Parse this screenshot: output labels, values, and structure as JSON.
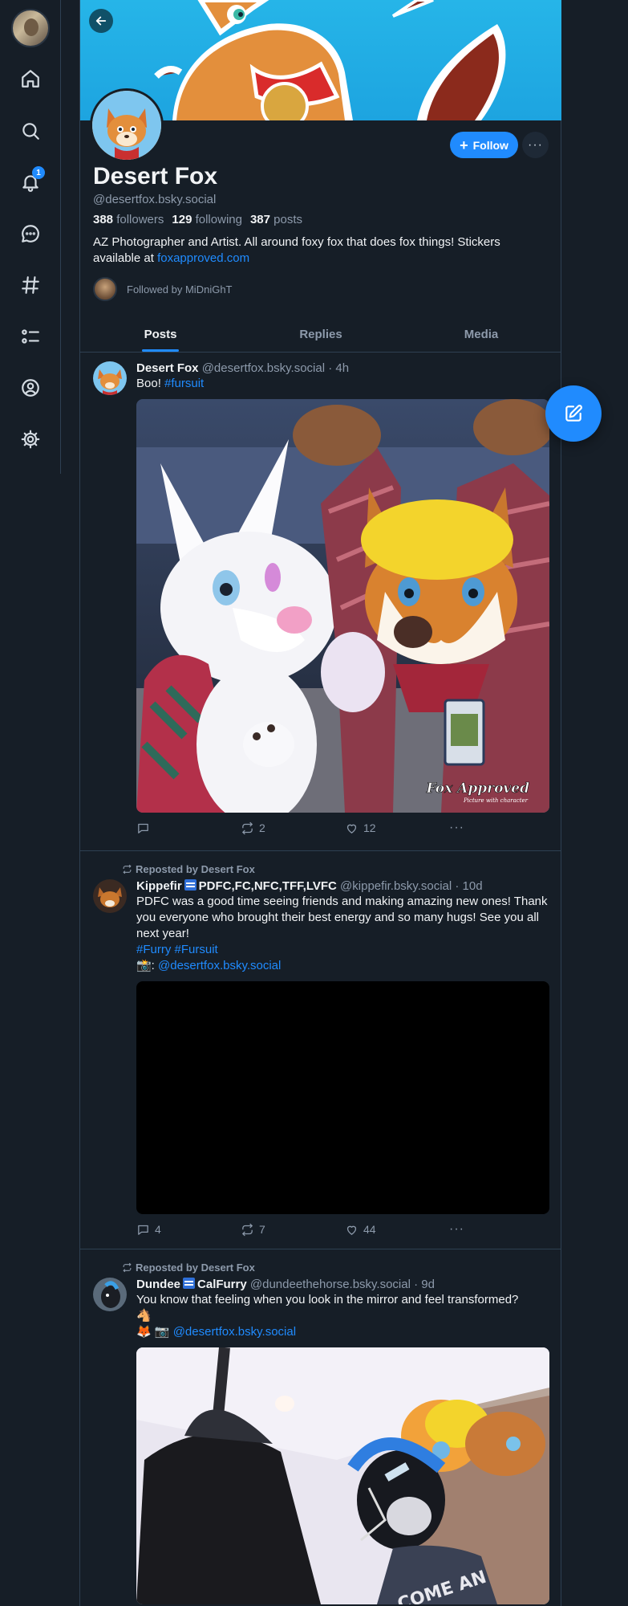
{
  "nav": {
    "notification_count": "1",
    "icons": [
      "home-icon",
      "search-icon",
      "bell-icon",
      "chat-icon",
      "hashtag-icon",
      "list-icon",
      "profile-icon",
      "settings-icon"
    ]
  },
  "profile": {
    "display_name": "Desert Fox",
    "handle": "@desertfox.bsky.social",
    "followers_count": "388",
    "followers_label": "followers",
    "following_count": "129",
    "following_label": "following",
    "posts_count": "387",
    "posts_label": "posts",
    "bio_text": "AZ Photographer and Artist. All around foxy fox that does fox things! Stickers available at ",
    "bio_link": "foxapproved.com",
    "followed_by": "Followed by MiDniGhT",
    "follow_label": "Follow",
    "more_label": "···"
  },
  "tabs": [
    {
      "label": "Posts",
      "active": true
    },
    {
      "label": "Replies",
      "active": false
    },
    {
      "label": "Media",
      "active": false
    }
  ],
  "posts": [
    {
      "author": "Desert Fox",
      "handle": "@desertfox.bsky.social",
      "time": "· 4h",
      "text": "Boo! ",
      "tag": "#fursuit",
      "replies": "",
      "reposts": "2",
      "likes": "12",
      "watermark_main": "Fox Approved",
      "watermark_sub": "Picture with character"
    },
    {
      "repost_label": "Reposted by Desert Fox",
      "author": "Kippefir",
      "author_suffix": "PDFC,FC,NFC,TFF,LVFC",
      "handle": "@kippefir.bsky.social",
      "time": "· 10d",
      "text": "PDFC was a good time seeing friends and making amazing new ones! Thank you everyone who brought their best energy and so many hugs! See you all next year!",
      "tags": "#Furry #Fursuit",
      "credit_prefix": "📸: ",
      "credit": "@desertfox.bsky.social",
      "replies": "4",
      "reposts": "7",
      "likes": "44"
    },
    {
      "repost_label": "Reposted by Desert Fox",
      "author": "Dundee",
      "author_suffix": "CalFurry",
      "handle": "@dundeethehorse.bsky.social",
      "time": "· 9d",
      "text": "You know that feeling when you look in the mirror and feel transformed?",
      "emoji_line": "🐴",
      "credit_prefix": "🦊 📷 ",
      "credit": "@desertfox.bsky.social",
      "shirt_text": "COME AN"
    }
  ],
  "colors": {
    "background": "#161e27",
    "accent": "#208bfe",
    "muted": "#8d9aab",
    "border": "#2e4052"
  }
}
